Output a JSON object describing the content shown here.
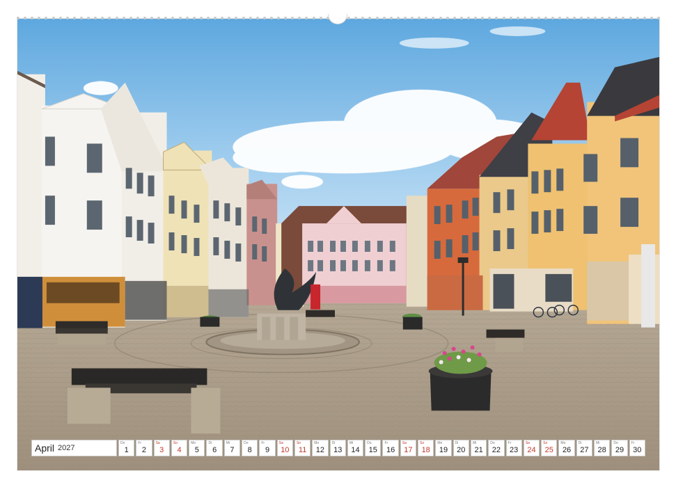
{
  "calendar": {
    "month": "April",
    "year": "2027",
    "accent_color": "#c0392b",
    "days": [
      {
        "dow": "Do",
        "num": "1"
      },
      {
        "dow": "Fr",
        "num": "2"
      },
      {
        "dow": "Sa",
        "num": "3",
        "weekend": true
      },
      {
        "dow": "So",
        "num": "4",
        "sunday": true
      },
      {
        "dow": "Mo",
        "num": "5"
      },
      {
        "dow": "Di",
        "num": "6"
      },
      {
        "dow": "Mi",
        "num": "7"
      },
      {
        "dow": "Do",
        "num": "8"
      },
      {
        "dow": "Fr",
        "num": "9"
      },
      {
        "dow": "Sa",
        "num": "10",
        "weekend": true
      },
      {
        "dow": "So",
        "num": "11",
        "sunday": true
      },
      {
        "dow": "Mo",
        "num": "12"
      },
      {
        "dow": "Di",
        "num": "13"
      },
      {
        "dow": "Mi",
        "num": "14"
      },
      {
        "dow": "Do",
        "num": "15"
      },
      {
        "dow": "Fr",
        "num": "16"
      },
      {
        "dow": "Sa",
        "num": "17",
        "weekend": true
      },
      {
        "dow": "So",
        "num": "18",
        "sunday": true
      },
      {
        "dow": "Mo",
        "num": "19"
      },
      {
        "dow": "Di",
        "num": "20"
      },
      {
        "dow": "Mi",
        "num": "21"
      },
      {
        "dow": "Do",
        "num": "22"
      },
      {
        "dow": "Fr",
        "num": "23"
      },
      {
        "dow": "Sa",
        "num": "24",
        "weekend": true
      },
      {
        "dow": "So",
        "num": "25",
        "sunday": true
      },
      {
        "dow": "Mo",
        "num": "26"
      },
      {
        "dow": "Di",
        "num": "27"
      },
      {
        "dow": "Mi",
        "num": "28"
      },
      {
        "dow": "Do",
        "num": "29"
      },
      {
        "dow": "Fr",
        "num": "30"
      }
    ]
  }
}
